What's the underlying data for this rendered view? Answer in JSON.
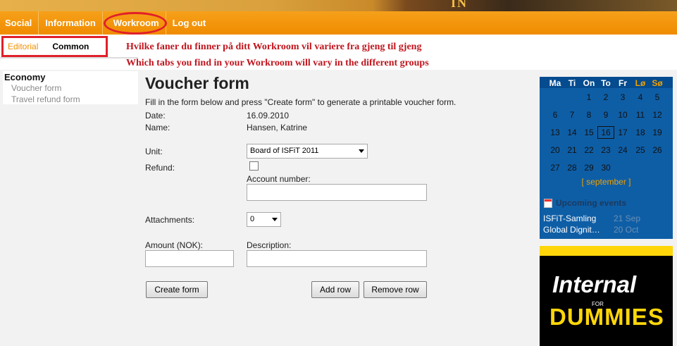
{
  "nav": {
    "tabs": [
      "Social",
      "Information",
      "Workroom",
      "Log out"
    ]
  },
  "subtabs": [
    "Editorial",
    "Common"
  ],
  "annotation": {
    "line1": "Hvilke faner du finner på ditt Workroom vil variere fra gjeng til gjeng",
    "line2": "Which tabs you find in your Workroom will vary in the different groups"
  },
  "sidebar": {
    "section": "Economy",
    "items": [
      "Voucher form",
      "Travel refund form"
    ]
  },
  "form": {
    "title": "Voucher form",
    "intro": "Fill in the form below and press \"Create form\" to generate a printable voucher form.",
    "date_label": "Date:",
    "date_value": "16.09.2010",
    "name_label": "Name:",
    "name_value": "Hansen, Katrine",
    "unit_label": "Unit:",
    "unit_value": "Board of ISFiT 2011",
    "refund_label": "Refund:",
    "account_label": "Account number:",
    "attachments_label": "Attachments:",
    "attachments_value": "0",
    "amount_label": "Amount (NOK):",
    "description_label": "Description:",
    "create_button": "Create form",
    "add_row_button": "Add row",
    "remove_row_button": "Remove row"
  },
  "calendar": {
    "weekdays": [
      "Ma",
      "Ti",
      "On",
      "To",
      "Fr",
      "Lø",
      "Sø"
    ],
    "weeks": [
      [
        "",
        "",
        "1",
        "2",
        "3",
        "4",
        "5"
      ],
      [
        "6",
        "7",
        "8",
        "9",
        "10",
        "11",
        "12"
      ],
      [
        "13",
        "14",
        "15",
        "16",
        "17",
        "18",
        "19"
      ],
      [
        "20",
        "21",
        "22",
        "23",
        "24",
        "25",
        "26"
      ],
      [
        "27",
        "28",
        "29",
        "30",
        "",
        "",
        ""
      ]
    ],
    "today": "16",
    "month_link": "[ september ]",
    "upcoming_title": "Upcoming events",
    "events": [
      {
        "name": "ISFiT-Samling",
        "date": "21 Sep"
      },
      {
        "name": "Global Dignit…",
        "date": "20 Oct"
      }
    ]
  },
  "ad": {
    "line1": "Internal",
    "line2": "FOR",
    "line3": "DUMMIES"
  },
  "colors": {
    "accent": "#f08c00",
    "annotation": "#c0161e",
    "calendar_bg": "#0e5ea6"
  }
}
